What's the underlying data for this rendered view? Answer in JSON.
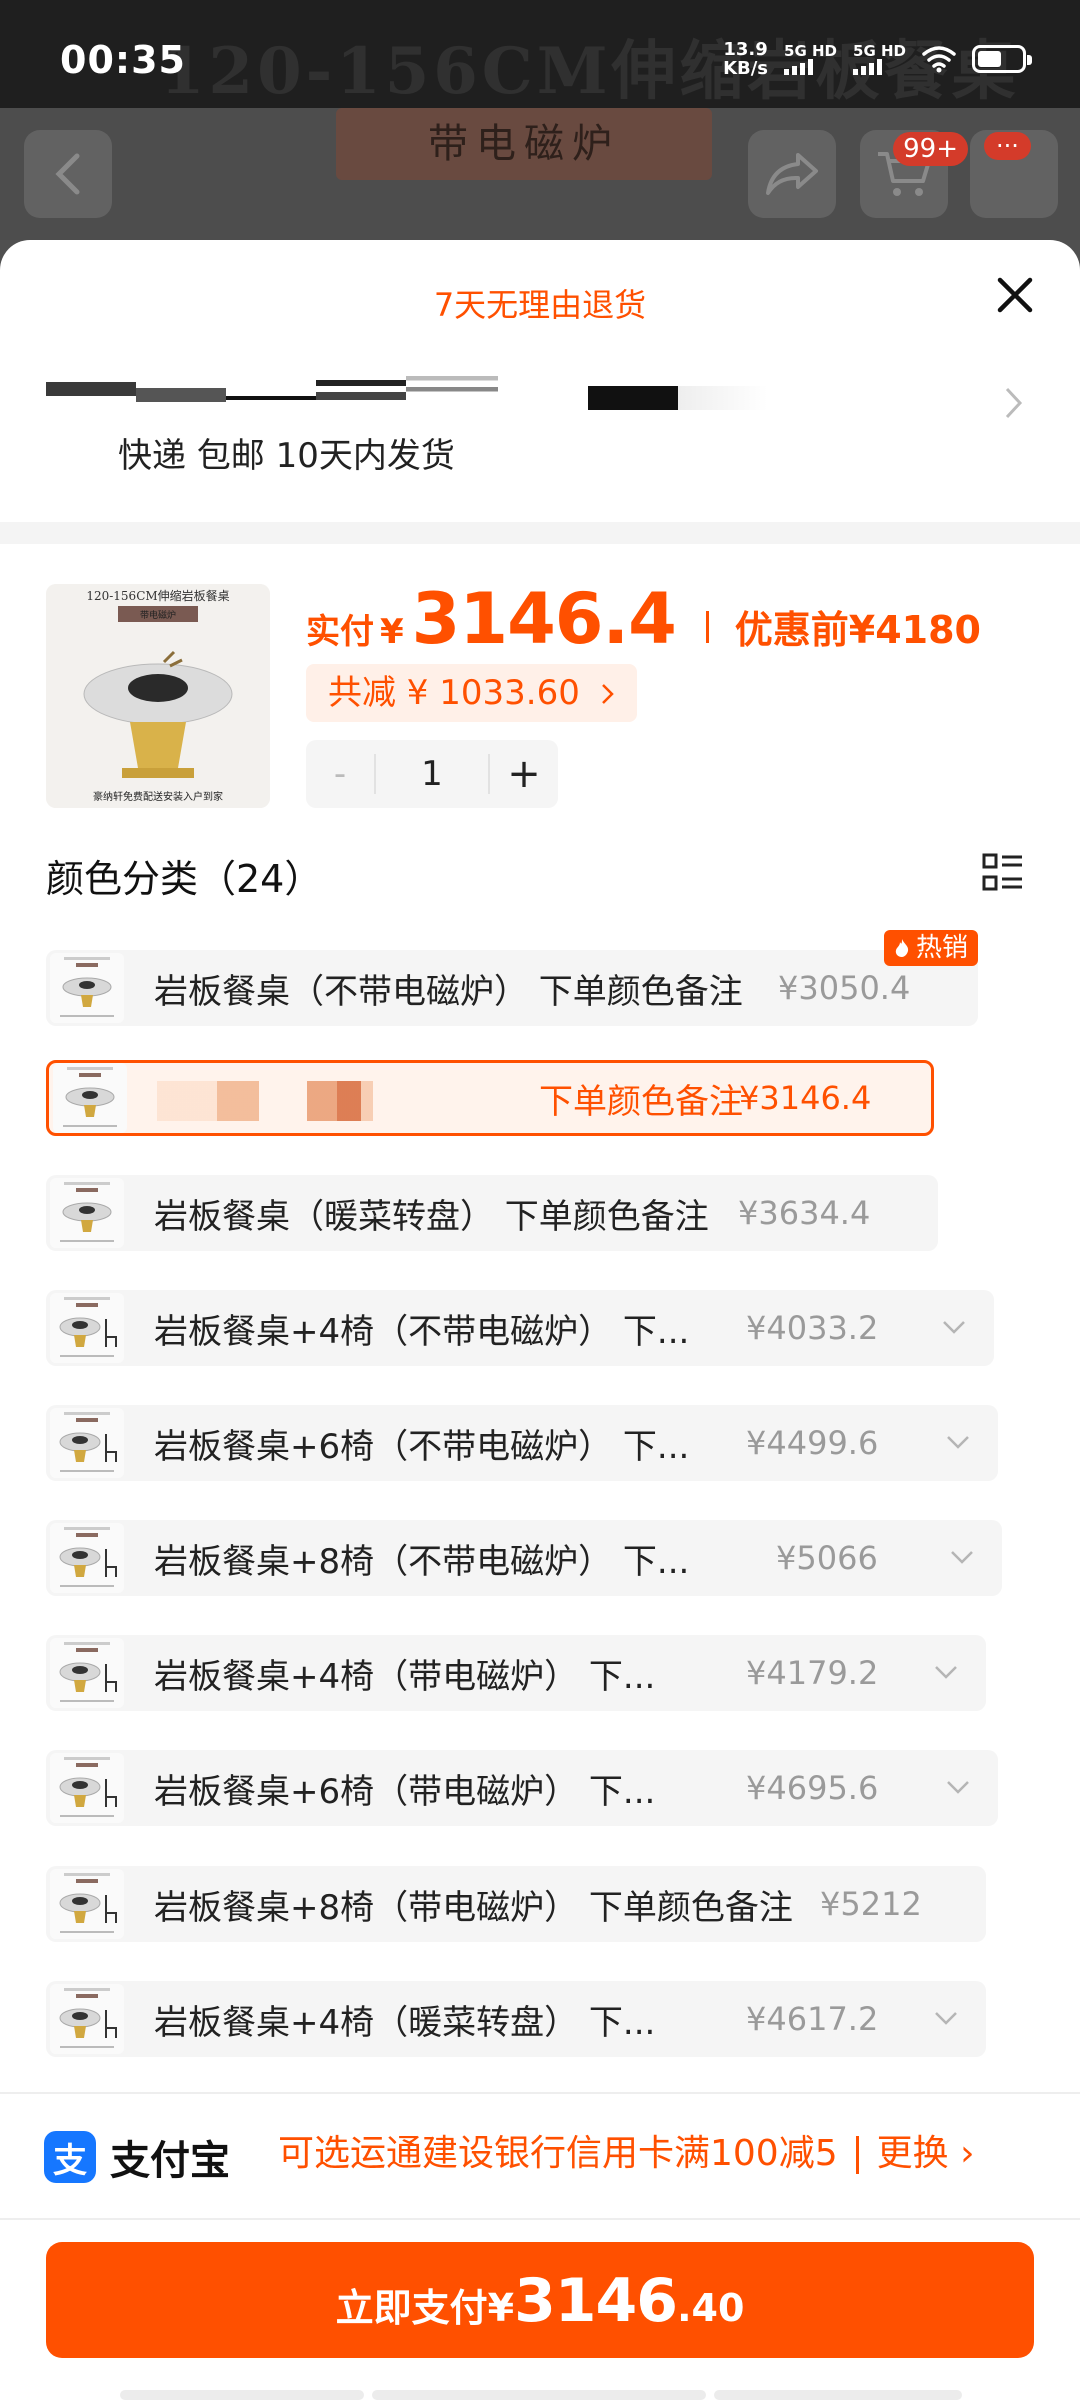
{
  "status_bar": {
    "time": "00:35",
    "net_speed_value": "13.9",
    "net_speed_unit": "KB/s",
    "sim1_label": "5G HD",
    "sim2_label": "5G HD",
    "battery_level": 0.55
  },
  "background": {
    "title": "120-156CM伸缩岩板餐桌",
    "banner": "带电磁炉",
    "cart_badge": "99+"
  },
  "sheet": {
    "returns_policy": "7天无理由退货",
    "shipping": "快递 包邮 10天内发货",
    "price_label": "实付",
    "currency": "¥",
    "price": "3146.4",
    "original_price": "优惠前¥4180",
    "discount": "共减 ¥ 1033.60",
    "quantity": "1",
    "minus": "-",
    "plus": "+",
    "category_title": "颜色分类（24）",
    "hot_tag": "热销",
    "product_image_text": {
      "title": "120-156CM伸缩岩板餐桌",
      "banner": "带电磁炉",
      "footer": "豪纳轩免费配送安装入户到家"
    }
  },
  "options": [
    {
      "label": "岩板餐桌（不带电磁炉） 下单颜色备注",
      "price": "¥3050.4",
      "dropdown": false,
      "hot": true,
      "selected": false,
      "chairs": false
    },
    {
      "label": "下单颜色备注",
      "price": "¥3146.4",
      "dropdown": false,
      "hot": false,
      "selected": true,
      "chairs": false
    },
    {
      "label": "岩板餐桌（暖菜转盘） 下单颜色备注",
      "price": "¥3634.4",
      "dropdown": false,
      "hot": false,
      "selected": false,
      "chairs": false
    },
    {
      "label": "岩板餐桌+4椅（不带电磁炉） 下...",
      "price": "¥4033.2",
      "dropdown": true,
      "hot": false,
      "selected": false,
      "chairs": true
    },
    {
      "label": "岩板餐桌+6椅（不带电磁炉） 下...",
      "price": "¥4499.6",
      "dropdown": true,
      "hot": false,
      "selected": false,
      "chairs": true
    },
    {
      "label": "岩板餐桌+8椅（不带电磁炉） 下...",
      "price": "¥5066",
      "dropdown": true,
      "hot": false,
      "selected": false,
      "chairs": true
    },
    {
      "label": "岩板餐桌+4椅（带电磁炉） 下...",
      "price": "¥4179.2",
      "dropdown": true,
      "hot": false,
      "selected": false,
      "chairs": true
    },
    {
      "label": "岩板餐桌+6椅（带电磁炉） 下...",
      "price": "¥4695.6",
      "dropdown": true,
      "hot": false,
      "selected": false,
      "chairs": true
    },
    {
      "label": "岩板餐桌+8椅（带电磁炉） 下单颜色备注",
      "price": "¥5212",
      "dropdown": false,
      "hot": false,
      "selected": false,
      "chairs": true
    },
    {
      "label": "岩板餐桌+4椅（暖菜转盘） 下...",
      "price": "¥4617.2",
      "dropdown": true,
      "hot": false,
      "selected": false,
      "chairs": true
    }
  ],
  "payment": {
    "method_icon": "支",
    "method_name": "支付宝",
    "promo": "可选运通建设银行信用卡满100减5",
    "change": "更换 ›",
    "button_prefix": "立即支付¥",
    "button_int": "3146",
    "button_dec": ".40"
  },
  "colors": {
    "accent": "#ff5000",
    "alipay_blue": "#1677ff",
    "selected_bg": "#fff3ec"
  }
}
